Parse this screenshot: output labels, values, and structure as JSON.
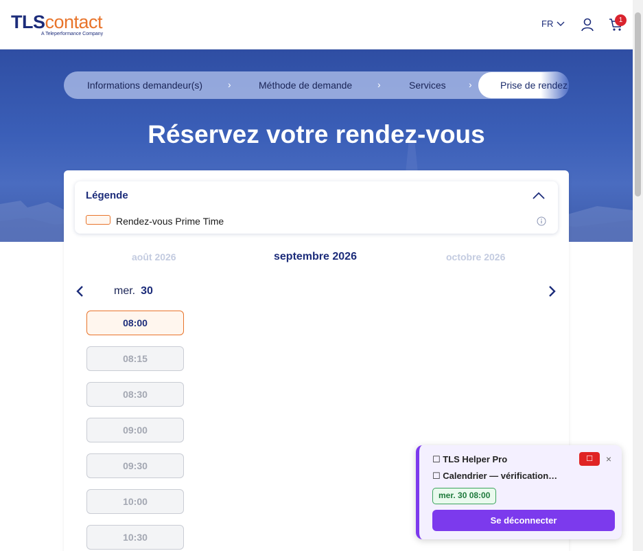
{
  "header": {
    "logo_tls": "TLS",
    "logo_contact": "contact",
    "logo_subtitle": "A Teleperformance Company",
    "language": "FR",
    "cart_count": "1"
  },
  "stepper": {
    "steps": [
      "Informations demandeur(s)",
      "Méthode de demande",
      "Services",
      "Prise de rendez"
    ],
    "separator": "›"
  },
  "hero": {
    "title": "Réservez votre rendez-vous"
  },
  "legend": {
    "title": "Légende",
    "item_label": "Rendez-vous Prime Time"
  },
  "calendar": {
    "prev_month": "août 2026",
    "current_month": "septembre 2026",
    "next_month": "octobre 2026",
    "day_name": "mer.",
    "day_number": "30",
    "slots": [
      "08:00",
      "08:15",
      "08:30",
      "09:00",
      "09:30",
      "10:00",
      "10:30"
    ],
    "prime_slot_index": 0
  },
  "helper": {
    "title": "☐ TLS Helper Pro",
    "status": "☐ Calendrier — vérification…",
    "stop_label": "☐",
    "close_label": "×",
    "found_badge": "mer. 30 08:00",
    "logout_label": "Se déconnecter"
  },
  "colors": {
    "brand_navy": "#1c2c7a",
    "brand_orange": "#e8742b",
    "helper_purple": "#7c3aed",
    "badge_red": "#d9232e"
  }
}
